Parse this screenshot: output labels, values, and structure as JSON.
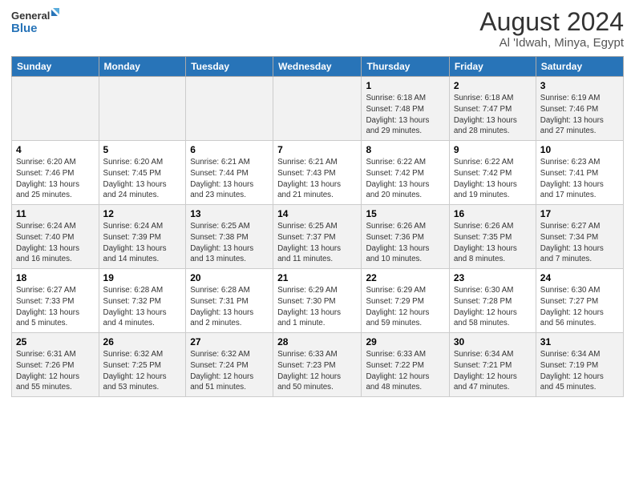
{
  "logo": {
    "line1": "General",
    "line2": "Blue"
  },
  "title": "August 2024",
  "subtitle": "Al 'Idwah, Minya, Egypt",
  "days_of_week": [
    "Sunday",
    "Monday",
    "Tuesday",
    "Wednesday",
    "Thursday",
    "Friday",
    "Saturday"
  ],
  "weeks": [
    [
      {
        "day": "",
        "info": ""
      },
      {
        "day": "",
        "info": ""
      },
      {
        "day": "",
        "info": ""
      },
      {
        "day": "",
        "info": ""
      },
      {
        "day": "1",
        "info": "Sunrise: 6:18 AM\nSunset: 7:48 PM\nDaylight: 13 hours\nand 29 minutes."
      },
      {
        "day": "2",
        "info": "Sunrise: 6:18 AM\nSunset: 7:47 PM\nDaylight: 13 hours\nand 28 minutes."
      },
      {
        "day": "3",
        "info": "Sunrise: 6:19 AM\nSunset: 7:46 PM\nDaylight: 13 hours\nand 27 minutes."
      }
    ],
    [
      {
        "day": "4",
        "info": "Sunrise: 6:20 AM\nSunset: 7:46 PM\nDaylight: 13 hours\nand 25 minutes."
      },
      {
        "day": "5",
        "info": "Sunrise: 6:20 AM\nSunset: 7:45 PM\nDaylight: 13 hours\nand 24 minutes."
      },
      {
        "day": "6",
        "info": "Sunrise: 6:21 AM\nSunset: 7:44 PM\nDaylight: 13 hours\nand 23 minutes."
      },
      {
        "day": "7",
        "info": "Sunrise: 6:21 AM\nSunset: 7:43 PM\nDaylight: 13 hours\nand 21 minutes."
      },
      {
        "day": "8",
        "info": "Sunrise: 6:22 AM\nSunset: 7:42 PM\nDaylight: 13 hours\nand 20 minutes."
      },
      {
        "day": "9",
        "info": "Sunrise: 6:22 AM\nSunset: 7:42 PM\nDaylight: 13 hours\nand 19 minutes."
      },
      {
        "day": "10",
        "info": "Sunrise: 6:23 AM\nSunset: 7:41 PM\nDaylight: 13 hours\nand 17 minutes."
      }
    ],
    [
      {
        "day": "11",
        "info": "Sunrise: 6:24 AM\nSunset: 7:40 PM\nDaylight: 13 hours\nand 16 minutes."
      },
      {
        "day": "12",
        "info": "Sunrise: 6:24 AM\nSunset: 7:39 PM\nDaylight: 13 hours\nand 14 minutes."
      },
      {
        "day": "13",
        "info": "Sunrise: 6:25 AM\nSunset: 7:38 PM\nDaylight: 13 hours\nand 13 minutes."
      },
      {
        "day": "14",
        "info": "Sunrise: 6:25 AM\nSunset: 7:37 PM\nDaylight: 13 hours\nand 11 minutes."
      },
      {
        "day": "15",
        "info": "Sunrise: 6:26 AM\nSunset: 7:36 PM\nDaylight: 13 hours\nand 10 minutes."
      },
      {
        "day": "16",
        "info": "Sunrise: 6:26 AM\nSunset: 7:35 PM\nDaylight: 13 hours\nand 8 minutes."
      },
      {
        "day": "17",
        "info": "Sunrise: 6:27 AM\nSunset: 7:34 PM\nDaylight: 13 hours\nand 7 minutes."
      }
    ],
    [
      {
        "day": "18",
        "info": "Sunrise: 6:27 AM\nSunset: 7:33 PM\nDaylight: 13 hours\nand 5 minutes."
      },
      {
        "day": "19",
        "info": "Sunrise: 6:28 AM\nSunset: 7:32 PM\nDaylight: 13 hours\nand 4 minutes."
      },
      {
        "day": "20",
        "info": "Sunrise: 6:28 AM\nSunset: 7:31 PM\nDaylight: 13 hours\nand 2 minutes."
      },
      {
        "day": "21",
        "info": "Sunrise: 6:29 AM\nSunset: 7:30 PM\nDaylight: 13 hours\nand 1 minute."
      },
      {
        "day": "22",
        "info": "Sunrise: 6:29 AM\nSunset: 7:29 PM\nDaylight: 12 hours\nand 59 minutes."
      },
      {
        "day": "23",
        "info": "Sunrise: 6:30 AM\nSunset: 7:28 PM\nDaylight: 12 hours\nand 58 minutes."
      },
      {
        "day": "24",
        "info": "Sunrise: 6:30 AM\nSunset: 7:27 PM\nDaylight: 12 hours\nand 56 minutes."
      }
    ],
    [
      {
        "day": "25",
        "info": "Sunrise: 6:31 AM\nSunset: 7:26 PM\nDaylight: 12 hours\nand 55 minutes."
      },
      {
        "day": "26",
        "info": "Sunrise: 6:32 AM\nSunset: 7:25 PM\nDaylight: 12 hours\nand 53 minutes."
      },
      {
        "day": "27",
        "info": "Sunrise: 6:32 AM\nSunset: 7:24 PM\nDaylight: 12 hours\nand 51 minutes."
      },
      {
        "day": "28",
        "info": "Sunrise: 6:33 AM\nSunset: 7:23 PM\nDaylight: 12 hours\nand 50 minutes."
      },
      {
        "day": "29",
        "info": "Sunrise: 6:33 AM\nSunset: 7:22 PM\nDaylight: 12 hours\nand 48 minutes."
      },
      {
        "day": "30",
        "info": "Sunrise: 6:34 AM\nSunset: 7:21 PM\nDaylight: 12 hours\nand 47 minutes."
      },
      {
        "day": "31",
        "info": "Sunrise: 6:34 AM\nSunset: 7:19 PM\nDaylight: 12 hours\nand 45 minutes."
      }
    ]
  ]
}
